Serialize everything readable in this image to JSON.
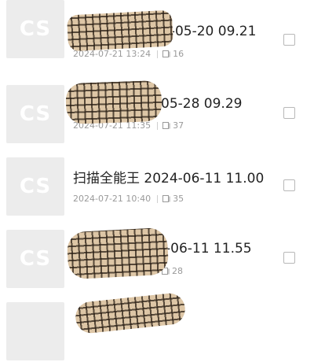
{
  "documents": [
    {
      "thumb_label": "CS",
      "title": "4-05-20 09.21",
      "date": "2024-07-21 13:24",
      "pages": "16",
      "title_partially_obscured": true
    },
    {
      "thumb_label": "CS",
      "title": "05-28 09.29",
      "date": "2024-07-21 11:35",
      "pages": "37",
      "title_partially_obscured": true
    },
    {
      "thumb_label": "CS",
      "title": "扫描全能王 2024-06-11 11.00",
      "date": "2024-07-21 10:40",
      "pages": "35",
      "title_partially_obscured": false
    },
    {
      "thumb_label": "CS",
      "title": "-06-11 11.55",
      "date": "",
      "pages": "28",
      "title_partially_obscured": true
    },
    {
      "thumb_label": "",
      "title": "",
      "date": "",
      "pages": "",
      "title_partially_obscured": true
    }
  ],
  "icons": {
    "page_count": "page-count-icon",
    "select": "checkbox"
  },
  "colors": {
    "thumb_bg": "#ececec",
    "title_text": "#222222",
    "meta_text": "#9a9a9a",
    "checkbox_border": "#b8b8b8"
  }
}
